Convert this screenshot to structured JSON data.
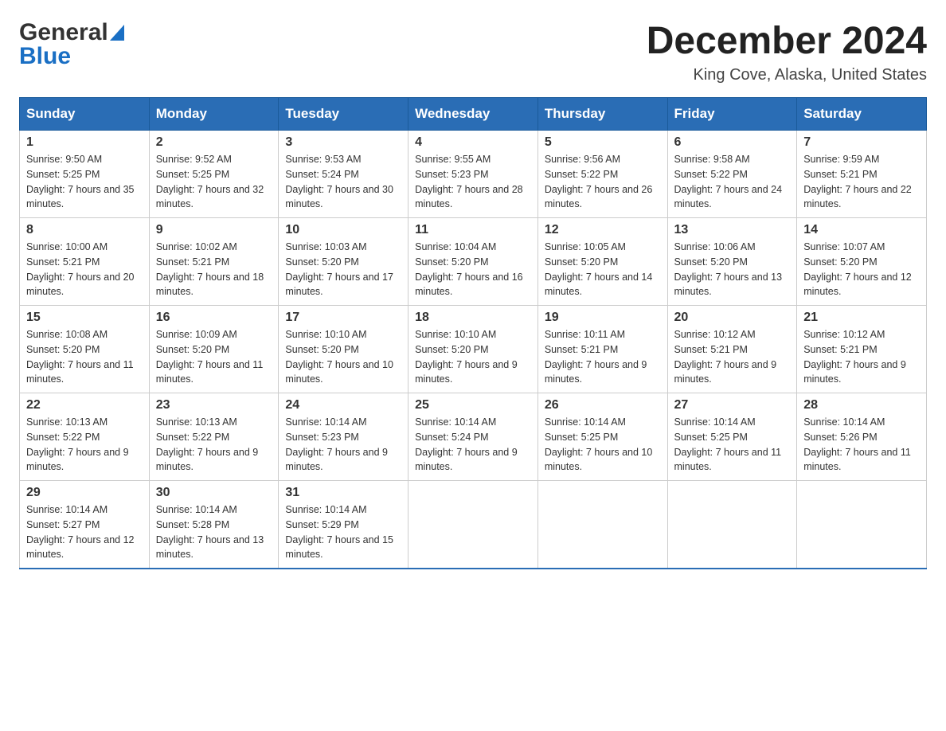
{
  "header": {
    "logo_general": "General",
    "logo_blue": "Blue",
    "title": "December 2024",
    "subtitle": "King Cove, Alaska, United States"
  },
  "days_of_week": [
    "Sunday",
    "Monday",
    "Tuesday",
    "Wednesday",
    "Thursday",
    "Friday",
    "Saturday"
  ],
  "weeks": [
    [
      {
        "day": "1",
        "sunrise": "9:50 AM",
        "sunset": "5:25 PM",
        "daylight": "7 hours and 35 minutes."
      },
      {
        "day": "2",
        "sunrise": "9:52 AM",
        "sunset": "5:25 PM",
        "daylight": "7 hours and 32 minutes."
      },
      {
        "day": "3",
        "sunrise": "9:53 AM",
        "sunset": "5:24 PM",
        "daylight": "7 hours and 30 minutes."
      },
      {
        "day": "4",
        "sunrise": "9:55 AM",
        "sunset": "5:23 PM",
        "daylight": "7 hours and 28 minutes."
      },
      {
        "day": "5",
        "sunrise": "9:56 AM",
        "sunset": "5:22 PM",
        "daylight": "7 hours and 26 minutes."
      },
      {
        "day": "6",
        "sunrise": "9:58 AM",
        "sunset": "5:22 PM",
        "daylight": "7 hours and 24 minutes."
      },
      {
        "day": "7",
        "sunrise": "9:59 AM",
        "sunset": "5:21 PM",
        "daylight": "7 hours and 22 minutes."
      }
    ],
    [
      {
        "day": "8",
        "sunrise": "10:00 AM",
        "sunset": "5:21 PM",
        "daylight": "7 hours and 20 minutes."
      },
      {
        "day": "9",
        "sunrise": "10:02 AM",
        "sunset": "5:21 PM",
        "daylight": "7 hours and 18 minutes."
      },
      {
        "day": "10",
        "sunrise": "10:03 AM",
        "sunset": "5:20 PM",
        "daylight": "7 hours and 17 minutes."
      },
      {
        "day": "11",
        "sunrise": "10:04 AM",
        "sunset": "5:20 PM",
        "daylight": "7 hours and 16 minutes."
      },
      {
        "day": "12",
        "sunrise": "10:05 AM",
        "sunset": "5:20 PM",
        "daylight": "7 hours and 14 minutes."
      },
      {
        "day": "13",
        "sunrise": "10:06 AM",
        "sunset": "5:20 PM",
        "daylight": "7 hours and 13 minutes."
      },
      {
        "day": "14",
        "sunrise": "10:07 AM",
        "sunset": "5:20 PM",
        "daylight": "7 hours and 12 minutes."
      }
    ],
    [
      {
        "day": "15",
        "sunrise": "10:08 AM",
        "sunset": "5:20 PM",
        "daylight": "7 hours and 11 minutes."
      },
      {
        "day": "16",
        "sunrise": "10:09 AM",
        "sunset": "5:20 PM",
        "daylight": "7 hours and 11 minutes."
      },
      {
        "day": "17",
        "sunrise": "10:10 AM",
        "sunset": "5:20 PM",
        "daylight": "7 hours and 10 minutes."
      },
      {
        "day": "18",
        "sunrise": "10:10 AM",
        "sunset": "5:20 PM",
        "daylight": "7 hours and 9 minutes."
      },
      {
        "day": "19",
        "sunrise": "10:11 AM",
        "sunset": "5:21 PM",
        "daylight": "7 hours and 9 minutes."
      },
      {
        "day": "20",
        "sunrise": "10:12 AM",
        "sunset": "5:21 PM",
        "daylight": "7 hours and 9 minutes."
      },
      {
        "day": "21",
        "sunrise": "10:12 AM",
        "sunset": "5:21 PM",
        "daylight": "7 hours and 9 minutes."
      }
    ],
    [
      {
        "day": "22",
        "sunrise": "10:13 AM",
        "sunset": "5:22 PM",
        "daylight": "7 hours and 9 minutes."
      },
      {
        "day": "23",
        "sunrise": "10:13 AM",
        "sunset": "5:22 PM",
        "daylight": "7 hours and 9 minutes."
      },
      {
        "day": "24",
        "sunrise": "10:14 AM",
        "sunset": "5:23 PM",
        "daylight": "7 hours and 9 minutes."
      },
      {
        "day": "25",
        "sunrise": "10:14 AM",
        "sunset": "5:24 PM",
        "daylight": "7 hours and 9 minutes."
      },
      {
        "day": "26",
        "sunrise": "10:14 AM",
        "sunset": "5:25 PM",
        "daylight": "7 hours and 10 minutes."
      },
      {
        "day": "27",
        "sunrise": "10:14 AM",
        "sunset": "5:25 PM",
        "daylight": "7 hours and 11 minutes."
      },
      {
        "day": "28",
        "sunrise": "10:14 AM",
        "sunset": "5:26 PM",
        "daylight": "7 hours and 11 minutes."
      }
    ],
    [
      {
        "day": "29",
        "sunrise": "10:14 AM",
        "sunset": "5:27 PM",
        "daylight": "7 hours and 12 minutes."
      },
      {
        "day": "30",
        "sunrise": "10:14 AM",
        "sunset": "5:28 PM",
        "daylight": "7 hours and 13 minutes."
      },
      {
        "day": "31",
        "sunrise": "10:14 AM",
        "sunset": "5:29 PM",
        "daylight": "7 hours and 15 minutes."
      },
      null,
      null,
      null,
      null
    ]
  ],
  "labels": {
    "sunrise_prefix": "Sunrise: ",
    "sunset_prefix": "Sunset: ",
    "daylight_prefix": "Daylight: "
  }
}
